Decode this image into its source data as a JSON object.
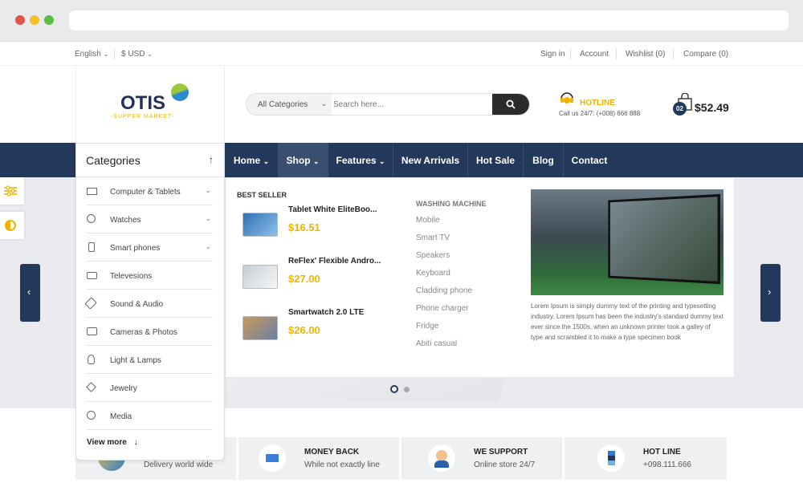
{
  "topbar": {
    "language": "English",
    "currency": "$ USD",
    "sign_in": "Sign in",
    "account": "Account",
    "wishlist": "Wishlist (0)",
    "compare": "Compare (0)"
  },
  "logo": {
    "name": "OTIS",
    "tagline": "-SUPPER MARKET-"
  },
  "search": {
    "category": "All Categories",
    "placeholder": "Search here..."
  },
  "hotline": {
    "title": "HOTLINE",
    "text": "Call us 24/7: (+008) 666 888"
  },
  "cart": {
    "count": "02",
    "total": "$52.49"
  },
  "categories": {
    "title": "Categories",
    "items": [
      {
        "label": "Computer & Tablets",
        "icon": "monitor-icon",
        "has_sub": true
      },
      {
        "label": "Watches",
        "icon": "watch-icon",
        "has_sub": true
      },
      {
        "label": "Smart phones",
        "icon": "phone-icon",
        "has_sub": true
      },
      {
        "label": "Televesions",
        "icon": "tv-icon",
        "has_sub": false
      },
      {
        "label": "Sound & Audio",
        "icon": "speaker-icon",
        "has_sub": false
      },
      {
        "label": "Cameras & Photos",
        "icon": "camera-icon",
        "has_sub": false
      },
      {
        "label": "Light & Lamps",
        "icon": "bulb-icon",
        "has_sub": false
      },
      {
        "label": "Jewelry",
        "icon": "diamond-icon",
        "has_sub": false
      },
      {
        "label": "Media",
        "icon": "media-icon",
        "has_sub": false
      }
    ],
    "view_more": "View more"
  },
  "nav": {
    "items": [
      "Home",
      "Shop",
      "Features",
      "New Arrivals",
      "Hot Sale",
      "Blog",
      "Contact"
    ],
    "active": "Shop"
  },
  "mega": {
    "best_seller_title": "BEST SELLER",
    "products": [
      {
        "name": "Tablet White EliteBoo...",
        "price": "$16.51"
      },
      {
        "name": "ReFlex' Flexible Andro...",
        "price": "$27.00"
      },
      {
        "name": "Smartwatch 2.0 LTE",
        "price": "$26.00"
      }
    ],
    "wm_title": "WASHING MACHINE",
    "wm_links": [
      "Mobile",
      "Smart TV",
      "Speakers",
      "Keyboard",
      "Cladding phone",
      "Phone charger",
      "Fridge",
      "Abiti casual"
    ],
    "promo_text": "Lorem Ipsum is simply dummy text of the printing and typesetting industry. Lorem Ipsum has been the industry's standard dummy text ever since the 1500s, when an unknown printer took a galley of type and scrambled it to make a type specimen book"
  },
  "services": [
    {
      "title": "",
      "sub": "Delivery world wide",
      "icon": "globe-icon"
    },
    {
      "title": "MONEY BACK",
      "sub": "While not exactly line",
      "icon": "card-icon"
    },
    {
      "title": "WE SUPPORT",
      "sub": "Online store 24/7",
      "icon": "support-icon"
    },
    {
      "title": "HOT LINE",
      "sub": "+098.111.666",
      "icon": "phone-stack-icon"
    }
  ],
  "colors": {
    "nav_bg": "#23395b",
    "accent": "#f0b400",
    "nav_active": "#3a4f70"
  }
}
